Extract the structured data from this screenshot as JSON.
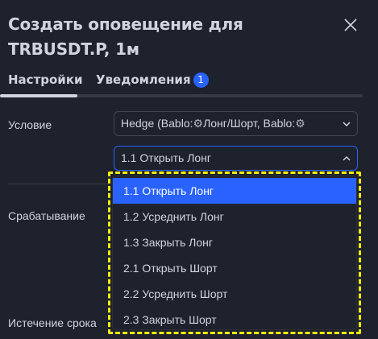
{
  "dialog": {
    "title": "Создать оповещение для TRBUSDT.P, 1м",
    "close_icon": "close-icon"
  },
  "tabs": {
    "settings_label": "Настройки",
    "notifications_label": "Уведомления",
    "notifications_badge": "1"
  },
  "form": {
    "condition_label": "Условие",
    "condition_value_part1": "Hedge (Bablo:",
    "condition_value_part2": "Лонг/Шорт, Bablo:",
    "condition_icon": "gear-icon",
    "signal_value": "1.1 Открыть Лонг",
    "trigger_label": "Срабатывание",
    "expire_label": "Истечение срока"
  },
  "dropdown": {
    "items": [
      {
        "label": "1.1 Открыть Лонг",
        "selected": true
      },
      {
        "label": "1.2 Усреднить Лонг",
        "selected": false
      },
      {
        "label": "1.3 Закрыть Лонг",
        "selected": false
      },
      {
        "label": "2.1 Открыть Шорт",
        "selected": false
      },
      {
        "label": "2.2 Усреднить Шорт",
        "selected": false
      },
      {
        "label": "2.3 Закрыть Шорт",
        "selected": false
      }
    ]
  },
  "colors": {
    "background": "#1e222d",
    "accent": "#2962ff",
    "highlight": "#f5f000",
    "text": "#d1d4dc"
  }
}
